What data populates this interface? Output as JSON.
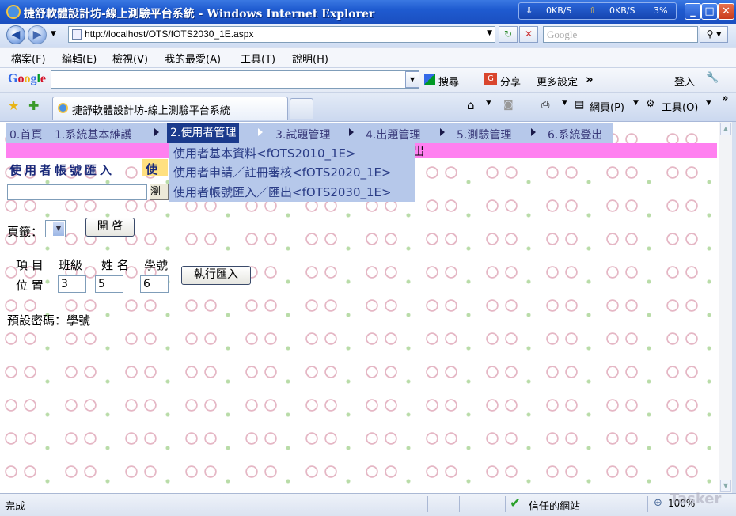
{
  "window": {
    "title": "捷舒軟體設計坊-線上測驗平台系統 - Windows Internet Explorer",
    "net_down": "0KB/S",
    "net_up": "0KB/S",
    "net_pct": "3%"
  },
  "address": {
    "url": "http://localhost/OTS/fOTS2030_1E.aspx",
    "search_placeholder": "Google"
  },
  "menubar": {
    "items": [
      "檔案(F)",
      "編輯(E)",
      "檢視(V)",
      "我的最愛(A)",
      "工具(T)",
      "說明(H)"
    ]
  },
  "google_toolbar": {
    "logo": "Google",
    "search_label": "搜尋",
    "share_label": "分享",
    "more_label": "更多設定",
    "signin_label": "登入"
  },
  "tabs": {
    "active_title": "捷舒軟體設計坊-線上測驗平台系統",
    "web_label": "網頁(P)",
    "tools_label": "工具(O)"
  },
  "site_menu": {
    "items": [
      "0.首頁",
      "1.系統基本維護",
      "2.使用者管理",
      "3.試題管理",
      "4.出題管理",
      "5.測驗管理",
      "6.系統登出"
    ],
    "submenu": [
      "使用者基本資料<fOTS2010_1E>",
      "使用者申請／註冊審核<fOTS2020_1E>",
      "使用者帳號匯入／匯出<fOTS2030_1E>"
    ],
    "pink_fragment": "出"
  },
  "page": {
    "title": "使用者帳號匯入",
    "tab_fragment": "使",
    "browse_label": "瀏",
    "sheet_label": "頁籤：",
    "open_button": "開 啓",
    "col_item": "項 目",
    "col_class": "班級",
    "col_name": "姓 名",
    "col_id": "學號",
    "row_position": "位 置",
    "class_pos": "3",
    "name_pos": "5",
    "id_pos": "6",
    "import_button": "執行匯入",
    "default_password": "預設密碼：學號"
  },
  "status": {
    "text": "完成",
    "zone": "信任的網站",
    "zoom": "100%",
    "watermark": "Tasker"
  },
  "colors": {
    "menu_bg": "#b6c8ea",
    "menu_active": "#1a3a8c",
    "pink_bar": "#ff80f0",
    "title_bar": "#1f5bd0"
  }
}
